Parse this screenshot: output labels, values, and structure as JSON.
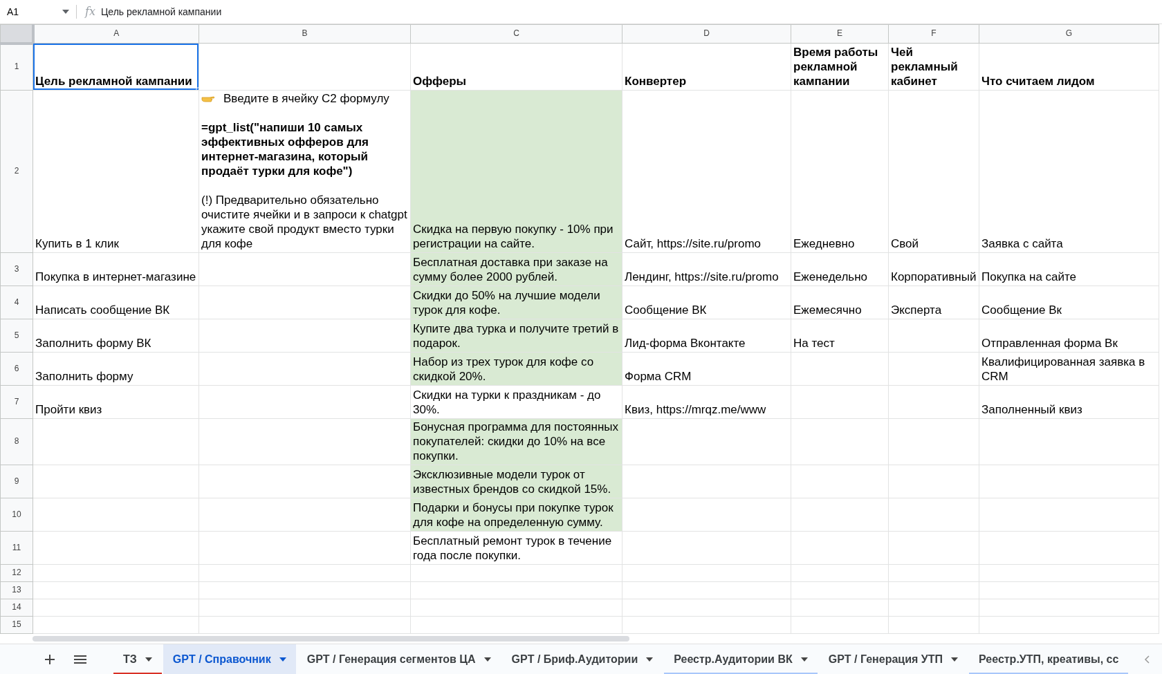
{
  "formula_bar": {
    "name_box": "A1",
    "fx_label": "fx",
    "formula": "Цель рекламной кампании"
  },
  "columns": [
    {
      "letter": "A"
    },
    {
      "letter": "B"
    },
    {
      "letter": "C"
    },
    {
      "letter": "D"
    },
    {
      "letter": "E"
    },
    {
      "letter": "F"
    },
    {
      "letter": "G"
    }
  ],
  "rows": [
    {
      "number": "1",
      "bold": true,
      "selected": true,
      "highlighted": false,
      "cells": [
        "Цель рекламной кампании",
        null,
        "Офферы",
        "Конвертер",
        "Время работы рекламной кампании",
        "Чей рекламный кабинет",
        "Что считаем лидом"
      ]
    },
    {
      "number": "2",
      "bold": false,
      "selected": false,
      "highlighted": true,
      "cells": [
        "Купить в 1 клик",
        {
          "kind": "instruction",
          "intro": "Введите в ячейку C2 формулу",
          "formula": "=gpt_list(\"напиши 10 самых эффективных офферов для интернет-магазина, который продаёт турки для кофе\")",
          "note": "(!) Предварительно обязательно очистите ячейки и в запроси к chatgpt укажите свой продукт вместо турки для кофе"
        },
        "Скидка на первую покупку - 10% при регистрации на сайте.",
        "Сайт, https://site.ru/promo",
        "Ежедневно",
        "Свой",
        "Заявка с сайта"
      ]
    },
    {
      "number": "3",
      "bold": false,
      "selected": false,
      "highlighted": true,
      "cells": [
        "Покупка в интернет-магазине",
        null,
        "Бесплатная доставка при заказе на сумму более 2000 рублей.",
        "Лендинг, https://site.ru/promo",
        "Еженедельно",
        "Корпоративный",
        "Покупка на сайте"
      ]
    },
    {
      "number": "4",
      "bold": false,
      "selected": false,
      "highlighted": true,
      "cells": [
        "Написать сообщение ВК",
        null,
        "Скидки до 50% на лучшие модели турок для кофе.",
        "Сообщение ВК",
        "Ежемесячно",
        "Эксперта",
        "Сообщение Вк"
      ]
    },
    {
      "number": "5",
      "bold": false,
      "selected": false,
      "highlighted": true,
      "cells": [
        "Заполнить форму ВК",
        null,
        "Купите два турка и получите третий в подарок.",
        "Лид-форма Вконтакте",
        "На тест",
        null,
        "Отправленная форма Вк"
      ]
    },
    {
      "number": "6",
      "bold": false,
      "selected": false,
      "highlighted": true,
      "cells": [
        "Заполнить форму",
        null,
        "Набор из трех турок для кофе со скидкой 20%.",
        "Форма CRM",
        null,
        null,
        "Квалифицированная заявка в CRM"
      ]
    },
    {
      "number": "7",
      "bold": false,
      "selected": false,
      "highlighted": false,
      "cells": [
        "Пройти квиз",
        null,
        "Скидки на турки к праздникам - до 30%.",
        "Квиз, https://mrqz.me/www",
        null,
        null,
        "Заполненный квиз"
      ]
    },
    {
      "number": "8",
      "bold": false,
      "selected": false,
      "highlighted": true,
      "cells": [
        null,
        null,
        "Бонусная программа для постоянных покупателей: скидки до 10% на все покупки.",
        null,
        null,
        null,
        null
      ]
    },
    {
      "number": "9",
      "bold": false,
      "selected": false,
      "highlighted": true,
      "cells": [
        null,
        null,
        "Эксклюзивные модели турок от известных брендов со скидкой 15%.",
        null,
        null,
        null,
        null
      ]
    },
    {
      "number": "10",
      "bold": false,
      "selected": false,
      "highlighted": true,
      "cells": [
        null,
        null,
        "Подарки и бонусы при покупке турок для кофе на определенную сумму.",
        null,
        null,
        null,
        null
      ]
    },
    {
      "number": "11",
      "bold": false,
      "selected": false,
      "highlighted": false,
      "cells": [
        null,
        null,
        "Бесплатный ремонт турок в течение года после покупки.",
        null,
        null,
        null,
        null
      ]
    },
    {
      "number": "12",
      "selected": false,
      "highlighted": false,
      "cells": []
    },
    {
      "number": "13",
      "selected": false,
      "highlighted": false,
      "cells": []
    },
    {
      "number": "14",
      "selected": false,
      "highlighted": false,
      "cells": []
    },
    {
      "number": "15",
      "selected": false,
      "highlighted": false,
      "cells": []
    }
  ],
  "sheet_tabs": [
    {
      "label": "ТЗ",
      "selected": false,
      "color": "#d93025"
    },
    {
      "label": "GPT / Справочник",
      "selected": true
    },
    {
      "label": "GPT / Генерация сегментов ЦА",
      "selected": false
    },
    {
      "label": "GPT / Бриф.Аудитории",
      "selected": false
    },
    {
      "label": "Реестр.Аудитории ВК",
      "selected": false,
      "color": "#a8c7fa"
    },
    {
      "label": "GPT / Генерация УТП",
      "selected": false
    },
    {
      "label": "Реестр.УТП, креативы, сс",
      "selected": false,
      "color": "#a8c7fa",
      "cut": true
    }
  ]
}
